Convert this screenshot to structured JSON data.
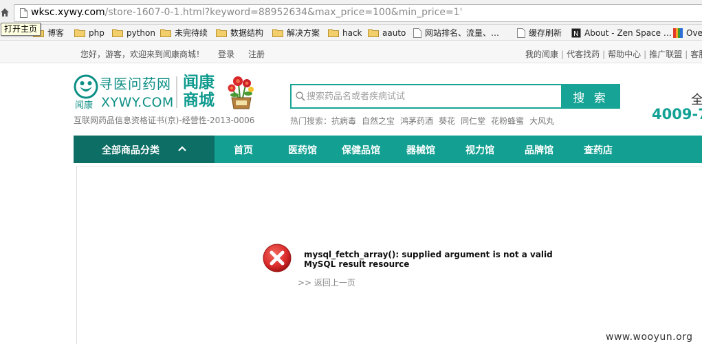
{
  "browser": {
    "url_host": "wksc.xywy.com",
    "url_path": "/store-1607-0-1.html?keyword=88952634&max_price=100&min_price=1'",
    "tooltip": "打开主页",
    "bookmarks": [
      {
        "label": "博客",
        "icon": "folder-icon"
      },
      {
        "label": "php",
        "icon": "folder-icon"
      },
      {
        "label": "python",
        "icon": "folder-icon"
      },
      {
        "label": "未完待续",
        "icon": "folder-icon"
      },
      {
        "label": "数据结构",
        "icon": "folder-icon"
      },
      {
        "label": "解决方案",
        "icon": "folder-icon"
      },
      {
        "label": "hack",
        "icon": "folder-icon"
      },
      {
        "label": "aauto",
        "icon": "folder-icon"
      },
      {
        "label": "网站排名、流量、…",
        "icon": "page-icon"
      },
      {
        "label": "缓存刷新",
        "icon": "page-icon"
      },
      {
        "label": "About - Zen Space …",
        "icon": "zen-icon"
      },
      {
        "label": "Over",
        "icon": "colorful-icon"
      }
    ]
  },
  "topbar": {
    "welcome": "您好，游客，欢迎来到闻康商城！",
    "login": "登录",
    "register": "注册",
    "links": [
      "我的闻康",
      "代客找药",
      "帮助中心",
      "推广联盟",
      "客服"
    ]
  },
  "header": {
    "logo_cn": "寻医问药网",
    "logo_sub": "闻康",
    "logo_en": "XYWY.COM",
    "mall": "闻康商城",
    "license": "互联网药品信息资格证书(京)-经营性-2013-0006",
    "search_placeholder": "搜索药品名或者疾病试试",
    "search_button": "搜 索",
    "hot_label": "热门搜索：",
    "hot_keywords": [
      "抗病毒",
      "自然之宝",
      "鸿茅药酒",
      "葵花",
      "同仁堂",
      "花粉蜂蜜",
      "大风丸"
    ],
    "phone_label": "全",
    "phone": "4009-7"
  },
  "nav": {
    "category": "全部商品分类",
    "items": [
      "首页",
      "医药馆",
      "保健品馆",
      "器械馆",
      "视力馆",
      "品牌馆",
      "查药店"
    ]
  },
  "error": {
    "message": "mysql_fetch_array(): supplied argument is not a valid MySQL result resource",
    "back": ">> 返回上一页"
  },
  "watermark": "www.wooyun.org",
  "colors": {
    "brand": "#13a092",
    "brand_dark": "#0c6e65",
    "error": "#d92b2b"
  }
}
